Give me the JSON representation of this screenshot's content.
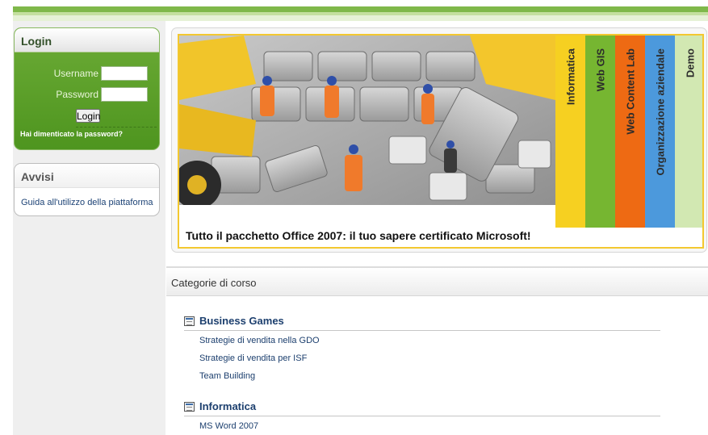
{
  "login": {
    "title": "Login",
    "username_label": "Username",
    "password_label": "Password",
    "button_label": "Login",
    "forgot_link": "Hai dimenticato la password?"
  },
  "avvisi": {
    "title": "Avvisi",
    "link": "Guida all'utilizzo della piattaforma"
  },
  "banner": {
    "caption": "Tutto il pacchetto Office 2007: il tuo sapere certificato Microsoft!",
    "tabs": [
      {
        "label": "Informatica",
        "color": "#f6d021"
      },
      {
        "label": "Web GIS",
        "color": "#76b631"
      },
      {
        "label": "Web Content Lab",
        "color": "#ee6a13"
      },
      {
        "label": "Organizzazione aziendale",
        "color": "#4c99dc"
      },
      {
        "label": "Demo",
        "color": "#d2e8b2"
      }
    ]
  },
  "categories": {
    "title": "Categorie di corso",
    "items": [
      {
        "name": "Business Games",
        "courses": [
          "Strategie di vendita nella GDO",
          "Strategie di vendita per ISF",
          "Team Building"
        ]
      },
      {
        "name": "Informatica",
        "courses": [
          "MS Word 2007"
        ]
      }
    ]
  },
  "colors": {
    "accent_green": "#5fa22b",
    "link_blue": "#1c3f6e"
  }
}
